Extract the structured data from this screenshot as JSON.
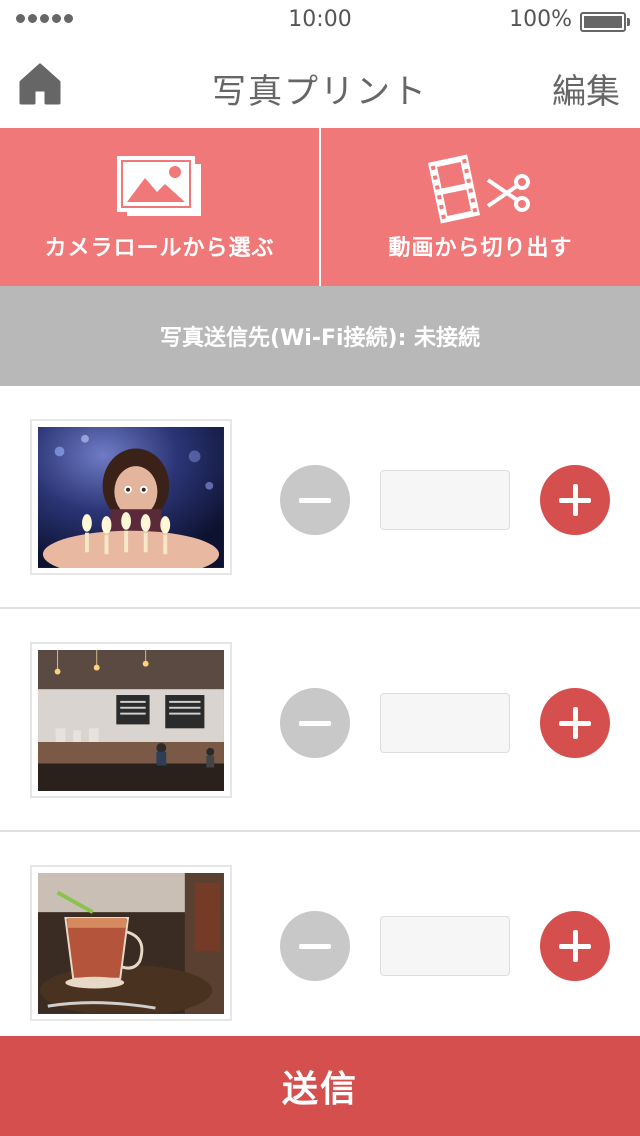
{
  "status_bar": {
    "time": "10:00",
    "battery": "100%"
  },
  "nav": {
    "title": "写真プリント",
    "edit_label": "編集"
  },
  "actions": {
    "camera_roll_label": "カメラロールから選ぶ",
    "video_clip_label": "動画から切り出す"
  },
  "banner": {
    "text": "写真送信先(Wi-Fi接続): 未接続"
  },
  "photos": [
    {
      "subject": "girl-with-birthday-candles",
      "quantity": ""
    },
    {
      "subject": "cafe-interior",
      "quantity": ""
    },
    {
      "subject": "drink-on-table",
      "quantity": ""
    }
  ],
  "send_label": "送信",
  "colors": {
    "accent": "#f07878",
    "primary": "#d64f4f",
    "banner": "#b8b8b8",
    "minus": "#c8c8c8"
  }
}
